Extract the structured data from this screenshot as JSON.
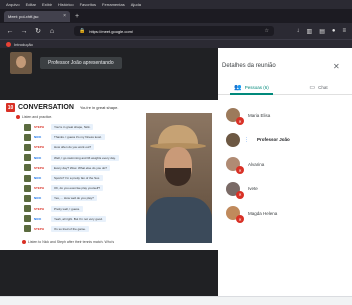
{
  "browser": {
    "menu": [
      "Arquivo",
      "Editar",
      "Exibir",
      "Histórico",
      "Favoritos",
      "Ferramentas",
      "Ajuda"
    ],
    "tab_title": "Meet: pol-xhtf-jsc",
    "url": "https://meet.google.com/",
    "bookmark_label": "Introdução"
  },
  "presenter": {
    "label": "Professor João apresentando"
  },
  "slide": {
    "number": "10",
    "title": "CONVERSATION",
    "subtitle": "You're in great shape.",
    "instruction": "Listen and practice.",
    "lines": [
      {
        "speaker": "STEPH",
        "text": "You're in great shape, Nick."
      },
      {
        "speaker": "NICK",
        "text": "Thanks. I guess it's my fitness level."
      },
      {
        "speaker": "STEPH",
        "text": "How often do you work out?"
      },
      {
        "speaker": "NICK",
        "text": "Well, I go swimming and lift weights every day."
      },
      {
        "speaker": "STEPH",
        "text": "Every day? Wow. What else do you do?"
      },
      {
        "speaker": "NICK",
        "text": "Sports? I'm a pretty fan of the Sox."
      },
      {
        "speaker": "STEPH",
        "text": "Oh, do you exercise play yourself?"
      },
      {
        "speaker": "NICK",
        "text": "Yes, ... How well do you play?"
      },
      {
        "speaker": "STEPH",
        "text": "Pretty well, I guess."
      },
      {
        "speaker": "NICK",
        "text": "Yeah, all right. But I'm not very good."
      },
      {
        "speaker": "STEPH",
        "text": "It's so tired of the game."
      }
    ],
    "bottom_instruction": "Listen to Nick and Steph after their tennis match. Who's"
  },
  "panel": {
    "title": "Detalhes da reunião",
    "tab_people": "Pessoas (6)",
    "tab_chat": "Chat",
    "people": [
      {
        "name": "Maria Elisa",
        "active": false
      },
      {
        "name": "Professor João",
        "active": true
      },
      {
        "name": "Alvarina",
        "active": false
      },
      {
        "name": "Ivete",
        "active": false
      },
      {
        "name": "Magda Helena",
        "active": false
      }
    ]
  },
  "colors": {
    "accent_teal": "#00897b",
    "mic_off_red": "#d93025",
    "browser_dark": "#2b2a33"
  }
}
